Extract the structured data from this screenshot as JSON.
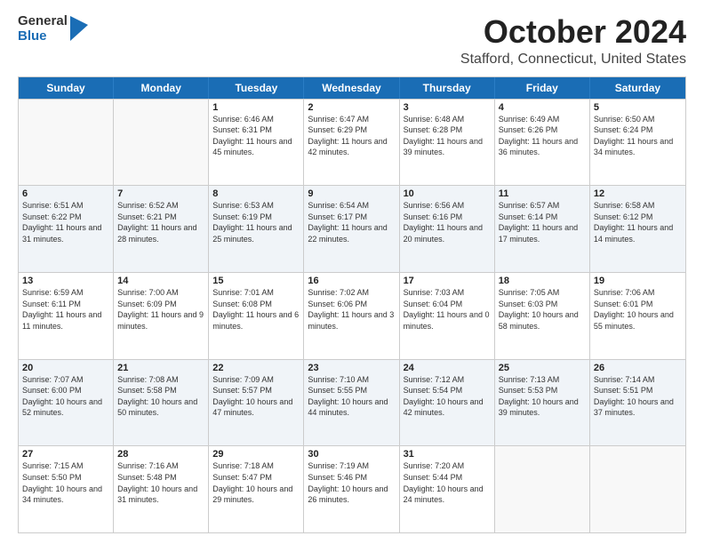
{
  "header": {
    "logo_general": "General",
    "logo_blue": "Blue",
    "month_title": "October 2024",
    "location": "Stafford, Connecticut, United States"
  },
  "calendar": {
    "days_of_week": [
      "Sunday",
      "Monday",
      "Tuesday",
      "Wednesday",
      "Thursday",
      "Friday",
      "Saturday"
    ],
    "rows": [
      [
        {
          "day": "",
          "info": ""
        },
        {
          "day": "",
          "info": ""
        },
        {
          "day": "1",
          "info": "Sunrise: 6:46 AM\nSunset: 6:31 PM\nDaylight: 11 hours and 45 minutes."
        },
        {
          "day": "2",
          "info": "Sunrise: 6:47 AM\nSunset: 6:29 PM\nDaylight: 11 hours and 42 minutes."
        },
        {
          "day": "3",
          "info": "Sunrise: 6:48 AM\nSunset: 6:28 PM\nDaylight: 11 hours and 39 minutes."
        },
        {
          "day": "4",
          "info": "Sunrise: 6:49 AM\nSunset: 6:26 PM\nDaylight: 11 hours and 36 minutes."
        },
        {
          "day": "5",
          "info": "Sunrise: 6:50 AM\nSunset: 6:24 PM\nDaylight: 11 hours and 34 minutes."
        }
      ],
      [
        {
          "day": "6",
          "info": "Sunrise: 6:51 AM\nSunset: 6:22 PM\nDaylight: 11 hours and 31 minutes."
        },
        {
          "day": "7",
          "info": "Sunrise: 6:52 AM\nSunset: 6:21 PM\nDaylight: 11 hours and 28 minutes."
        },
        {
          "day": "8",
          "info": "Sunrise: 6:53 AM\nSunset: 6:19 PM\nDaylight: 11 hours and 25 minutes."
        },
        {
          "day": "9",
          "info": "Sunrise: 6:54 AM\nSunset: 6:17 PM\nDaylight: 11 hours and 22 minutes."
        },
        {
          "day": "10",
          "info": "Sunrise: 6:56 AM\nSunset: 6:16 PM\nDaylight: 11 hours and 20 minutes."
        },
        {
          "day": "11",
          "info": "Sunrise: 6:57 AM\nSunset: 6:14 PM\nDaylight: 11 hours and 17 minutes."
        },
        {
          "day": "12",
          "info": "Sunrise: 6:58 AM\nSunset: 6:12 PM\nDaylight: 11 hours and 14 minutes."
        }
      ],
      [
        {
          "day": "13",
          "info": "Sunrise: 6:59 AM\nSunset: 6:11 PM\nDaylight: 11 hours and 11 minutes."
        },
        {
          "day": "14",
          "info": "Sunrise: 7:00 AM\nSunset: 6:09 PM\nDaylight: 11 hours and 9 minutes."
        },
        {
          "day": "15",
          "info": "Sunrise: 7:01 AM\nSunset: 6:08 PM\nDaylight: 11 hours and 6 minutes."
        },
        {
          "day": "16",
          "info": "Sunrise: 7:02 AM\nSunset: 6:06 PM\nDaylight: 11 hours and 3 minutes."
        },
        {
          "day": "17",
          "info": "Sunrise: 7:03 AM\nSunset: 6:04 PM\nDaylight: 11 hours and 0 minutes."
        },
        {
          "day": "18",
          "info": "Sunrise: 7:05 AM\nSunset: 6:03 PM\nDaylight: 10 hours and 58 minutes."
        },
        {
          "day": "19",
          "info": "Sunrise: 7:06 AM\nSunset: 6:01 PM\nDaylight: 10 hours and 55 minutes."
        }
      ],
      [
        {
          "day": "20",
          "info": "Sunrise: 7:07 AM\nSunset: 6:00 PM\nDaylight: 10 hours and 52 minutes."
        },
        {
          "day": "21",
          "info": "Sunrise: 7:08 AM\nSunset: 5:58 PM\nDaylight: 10 hours and 50 minutes."
        },
        {
          "day": "22",
          "info": "Sunrise: 7:09 AM\nSunset: 5:57 PM\nDaylight: 10 hours and 47 minutes."
        },
        {
          "day": "23",
          "info": "Sunrise: 7:10 AM\nSunset: 5:55 PM\nDaylight: 10 hours and 44 minutes."
        },
        {
          "day": "24",
          "info": "Sunrise: 7:12 AM\nSunset: 5:54 PM\nDaylight: 10 hours and 42 minutes."
        },
        {
          "day": "25",
          "info": "Sunrise: 7:13 AM\nSunset: 5:53 PM\nDaylight: 10 hours and 39 minutes."
        },
        {
          "day": "26",
          "info": "Sunrise: 7:14 AM\nSunset: 5:51 PM\nDaylight: 10 hours and 37 minutes."
        }
      ],
      [
        {
          "day": "27",
          "info": "Sunrise: 7:15 AM\nSunset: 5:50 PM\nDaylight: 10 hours and 34 minutes."
        },
        {
          "day": "28",
          "info": "Sunrise: 7:16 AM\nSunset: 5:48 PM\nDaylight: 10 hours and 31 minutes."
        },
        {
          "day": "29",
          "info": "Sunrise: 7:18 AM\nSunset: 5:47 PM\nDaylight: 10 hours and 29 minutes."
        },
        {
          "day": "30",
          "info": "Sunrise: 7:19 AM\nSunset: 5:46 PM\nDaylight: 10 hours and 26 minutes."
        },
        {
          "day": "31",
          "info": "Sunrise: 7:20 AM\nSunset: 5:44 PM\nDaylight: 10 hours and 24 minutes."
        },
        {
          "day": "",
          "info": ""
        },
        {
          "day": "",
          "info": ""
        }
      ]
    ]
  }
}
